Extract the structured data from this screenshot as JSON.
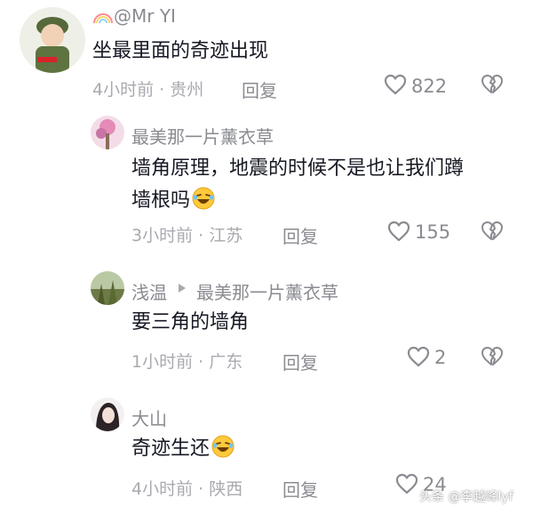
{
  "comments": [
    {
      "username": "@Mr YI",
      "text": "坐最里面的奇迹出现",
      "time": "4小时前",
      "location": "贵州",
      "reply_label": "回复",
      "likes": "822"
    },
    {
      "username": "最美那一片薰衣草",
      "text_line1": "墙角原理，地震的时候不是也让我们蹲",
      "text_line2": "墙根吗",
      "time": "3小时前",
      "location": "江苏",
      "reply_label": "回复",
      "likes": "155"
    },
    {
      "username": "浅温",
      "reply_to": "最美那一片薰衣草",
      "text": "要三角的墙角",
      "time": "1小时前",
      "location": "广东",
      "reply_label": "回复",
      "likes": "2"
    },
    {
      "username": "大山",
      "text": "奇迹生还",
      "time": "4小时前",
      "location": "陕西",
      "reply_label": "回复",
      "likes": "24"
    }
  ],
  "separator": "·",
  "watermark": "头条 @李越峰lyf",
  "colors": {
    "text": "#161823",
    "username": "#8a8b91",
    "meta": "#a9aab0",
    "icon": "#8a8b91"
  },
  "icons": [
    "rainbow-icon",
    "heart-icon",
    "broken-heart-icon",
    "play-triangle-icon",
    "laughing-emoji-icon"
  ]
}
